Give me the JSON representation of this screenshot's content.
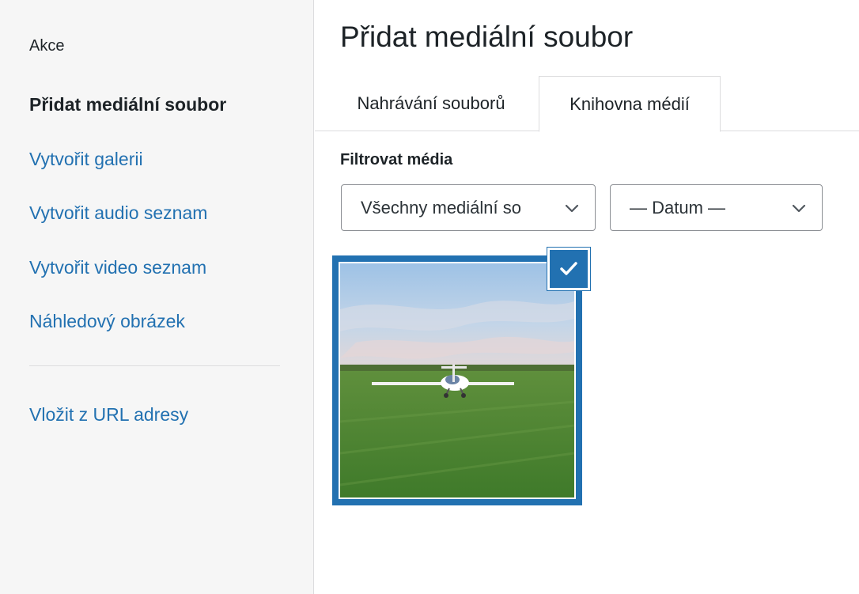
{
  "sidebar": {
    "heading": "Akce",
    "items": [
      {
        "label": "Přidat mediální soubor",
        "active": true
      },
      {
        "label": "Vytvořit galerii"
      },
      {
        "label": "Vytvořit audio seznam"
      },
      {
        "label": "Vytvořit video seznam"
      },
      {
        "label": "Náhledový obrázek"
      }
    ],
    "url_item": "Vložit z URL adresy"
  },
  "main": {
    "title": "Přidat mediální soubor",
    "tabs": [
      {
        "label": "Nahrávání souborů"
      },
      {
        "label": "Knihovna médií",
        "active": true
      }
    ],
    "filter": {
      "label": "Filtrovat média",
      "type_select": "Všechny mediální so",
      "date_select": "— Datum —"
    },
    "attachment": {
      "selected": true,
      "icon": "check-icon"
    }
  },
  "colors": {
    "accent": "#2271b1",
    "sidebar_bg": "#f6f6f6",
    "text": "#1d2327"
  }
}
